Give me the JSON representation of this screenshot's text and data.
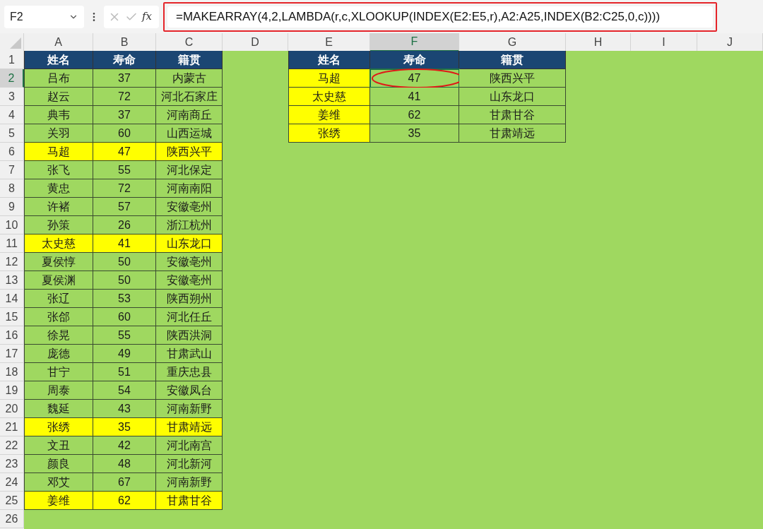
{
  "name_box": {
    "value": "F2"
  },
  "formula_bar": {
    "function_label": "fx",
    "formula": "=MAKEARRAY(4,2,LAMBDA(r,c,XLOOKUP(INDEX(E2:E5,r),A2:A25,INDEX(B2:C25,0,c))))",
    "outlined": true
  },
  "columns": [
    {
      "label": "A",
      "selected": false
    },
    {
      "label": "B",
      "selected": false
    },
    {
      "label": "C",
      "selected": false
    },
    {
      "label": "D",
      "selected": false
    },
    {
      "label": "E",
      "selected": false
    },
    {
      "label": "F",
      "selected": true
    },
    {
      "label": "G",
      "selected": false
    },
    {
      "label": "H",
      "selected": false
    },
    {
      "label": "I",
      "selected": false
    },
    {
      "label": "J",
      "selected": false
    }
  ],
  "rows": [
    {
      "label": "1",
      "selected": false
    },
    {
      "label": "2",
      "selected": true
    },
    {
      "label": "3",
      "selected": false
    },
    {
      "label": "4",
      "selected": false
    },
    {
      "label": "5",
      "selected": false
    },
    {
      "label": "6",
      "selected": false
    },
    {
      "label": "7",
      "selected": false
    },
    {
      "label": "8",
      "selected": false
    },
    {
      "label": "9",
      "selected": false
    },
    {
      "label": "10",
      "selected": false
    },
    {
      "label": "11",
      "selected": false
    },
    {
      "label": "12",
      "selected": false
    },
    {
      "label": "13",
      "selected": false
    },
    {
      "label": "14",
      "selected": false
    },
    {
      "label": "15",
      "selected": false
    },
    {
      "label": "16",
      "selected": false
    },
    {
      "label": "17",
      "selected": false
    },
    {
      "label": "18",
      "selected": false
    },
    {
      "label": "19",
      "selected": false
    },
    {
      "label": "20",
      "selected": false
    },
    {
      "label": "21",
      "selected": false
    },
    {
      "label": "22",
      "selected": false
    },
    {
      "label": "23",
      "selected": false
    },
    {
      "label": "24",
      "selected": false
    },
    {
      "label": "25",
      "selected": false
    },
    {
      "label": "26",
      "selected": false
    }
  ],
  "source_table": {
    "headers": [
      "姓名",
      "寿命",
      "籍贯"
    ],
    "rows": [
      {
        "cells": [
          "吕布",
          "37",
          "内蒙古"
        ],
        "highlighted": false
      },
      {
        "cells": [
          "赵云",
          "72",
          "河北石家庄"
        ],
        "highlighted": false
      },
      {
        "cells": [
          "典韦",
          "37",
          "河南商丘"
        ],
        "highlighted": false
      },
      {
        "cells": [
          "关羽",
          "60",
          "山西运城"
        ],
        "highlighted": false
      },
      {
        "cells": [
          "马超",
          "47",
          "陕西兴平"
        ],
        "highlighted": true
      },
      {
        "cells": [
          "张飞",
          "55",
          "河北保定"
        ],
        "highlighted": false
      },
      {
        "cells": [
          "黄忠",
          "72",
          "河南南阳"
        ],
        "highlighted": false
      },
      {
        "cells": [
          "许褚",
          "57",
          "安徽亳州"
        ],
        "highlighted": false
      },
      {
        "cells": [
          "孙策",
          "26",
          "浙江杭州"
        ],
        "highlighted": false
      },
      {
        "cells": [
          "太史慈",
          "41",
          "山东龙口"
        ],
        "highlighted": true
      },
      {
        "cells": [
          "夏侯惇",
          "50",
          "安徽亳州"
        ],
        "highlighted": false
      },
      {
        "cells": [
          "夏侯渊",
          "50",
          "安徽亳州"
        ],
        "highlighted": false
      },
      {
        "cells": [
          "张辽",
          "53",
          "陕西朔州"
        ],
        "highlighted": false
      },
      {
        "cells": [
          "张郃",
          "60",
          "河北任丘"
        ],
        "highlighted": false
      },
      {
        "cells": [
          "徐晃",
          "55",
          "陕西洪洞"
        ],
        "highlighted": false
      },
      {
        "cells": [
          "庞德",
          "49",
          "甘肃武山"
        ],
        "highlighted": false
      },
      {
        "cells": [
          "甘宁",
          "51",
          "重庆忠县"
        ],
        "highlighted": false
      },
      {
        "cells": [
          "周泰",
          "54",
          "安徽凤台"
        ],
        "highlighted": false
      },
      {
        "cells": [
          "魏延",
          "43",
          "河南新野"
        ],
        "highlighted": false
      },
      {
        "cells": [
          "张绣",
          "35",
          "甘肃靖远"
        ],
        "highlighted": true
      },
      {
        "cells": [
          "文丑",
          "42",
          "河北南宫"
        ],
        "highlighted": false
      },
      {
        "cells": [
          "颜良",
          "48",
          "河北新河"
        ],
        "highlighted": false
      },
      {
        "cells": [
          "邓艾",
          "67",
          "河南新野"
        ],
        "highlighted": false
      },
      {
        "cells": [
          "姜维",
          "62",
          "甘肃甘谷"
        ],
        "highlighted": true
      }
    ]
  },
  "result_table": {
    "headers": [
      "姓名",
      "寿命",
      "籍贯"
    ],
    "rows": [
      {
        "name": "马超",
        "lifespan": "47",
        "origin": "陕西兴平",
        "name_highlighted": true,
        "selected": true,
        "circled": true
      },
      {
        "name": "太史慈",
        "lifespan": "41",
        "origin": "山东龙口",
        "name_highlighted": true,
        "selected": false,
        "circled": false
      },
      {
        "name": "姜维",
        "lifespan": "62",
        "origin": "甘肃甘谷",
        "name_highlighted": true,
        "selected": false,
        "circled": false
      },
      {
        "name": "张绣",
        "lifespan": "35",
        "origin": "甘肃靖远",
        "name_highlighted": true,
        "selected": false,
        "circled": false
      }
    ]
  }
}
